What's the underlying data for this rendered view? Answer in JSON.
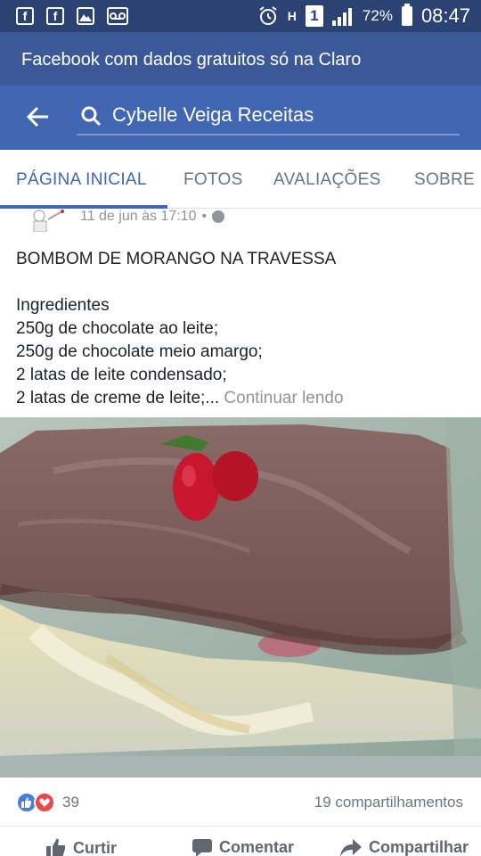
{
  "status_bar": {
    "icons_left": [
      "facebook-icon",
      "facebook-icon",
      "gallery-icon",
      "voicemail-icon"
    ],
    "left_glyphs": [
      "f",
      "f"
    ],
    "sim_label": "1",
    "network": "H",
    "battery": "72%",
    "time": "08:47"
  },
  "banner": {
    "text": "Facebook com dados gratuitos só na Claro"
  },
  "header": {
    "search_text": "Cybelle Veiga Receitas"
  },
  "tabs": [
    {
      "label": "PÁGINA INICIAL",
      "active": true
    },
    {
      "label": "FOTOS"
    },
    {
      "label": "AVALIAÇÕES"
    },
    {
      "label": "SOBRE"
    }
  ],
  "post": {
    "date": "11 de jun às 17:10",
    "separator": "•",
    "title": "BOMBOM DE MORANGO NA TRAVESSA",
    "lines": [
      "Ingredientes",
      "250g de chocolate ao leite;",
      "250g de chocolate meio amargo;",
      "2 latas de leite condensado;",
      "2 latas de creme de leite;..."
    ],
    "more_link": "Continuar lendo"
  },
  "reactions": {
    "count": "39",
    "shares": "19 compartilhamentos"
  },
  "actions": {
    "like": "Curtir",
    "comment": "Comentar",
    "share": "Compartilhar"
  },
  "colors": {
    "fb_blue": "#4267b2",
    "banner": "#3b5998",
    "status": "#2b4272"
  }
}
